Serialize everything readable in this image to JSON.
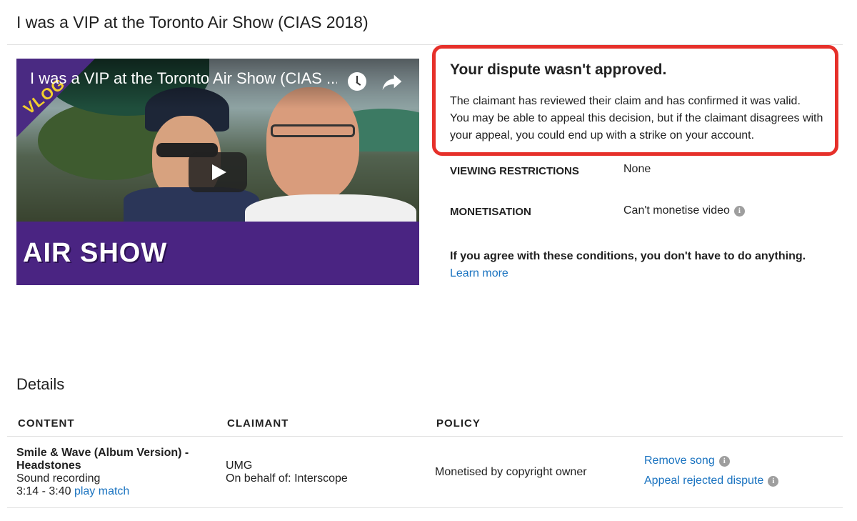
{
  "page_title": "I was a VIP at the Toronto Air Show (CIAS 2018)",
  "video": {
    "overlay_title": "I was a VIP at the Toronto Air Show (CIAS ...",
    "badge_text": "VLOG",
    "banner_text": "AIR SHOW"
  },
  "dispute": {
    "title": "Your dispute wasn't approved.",
    "line1": "The claimant has reviewed their claim and has confirmed it was valid.",
    "line2": "You may be able to appeal this decision, but if the claimant disagrees with",
    "line3": "your appeal, you could end up with a strike on your account.",
    "border_color": "#e6302a"
  },
  "restrictions": {
    "viewing_label": "VIEWING RESTRICTIONS",
    "viewing_value": "None",
    "monetisation_label": "MONETISATION",
    "monetisation_value": "Can't monetise video"
  },
  "notice": {
    "agree_text": "If you agree with these conditions, you don't have to do anything.",
    "learn_more": "Learn more"
  },
  "details": {
    "heading": "Details",
    "columns": [
      "CONTENT",
      "CLAIMANT",
      "POLICY"
    ],
    "row": {
      "content_title_line1": "Smile & Wave (Album Version) -",
      "content_title_line2": "Headstones",
      "content_type": "Sound recording",
      "time_range": "3:14 - 3:40",
      "play_match": "play match",
      "claimant": "UMG",
      "claimant_behalf": "On behalf of: Interscope",
      "policy": "Monetised by copyright owner",
      "actions": [
        "Remove song",
        "Appeal rejected dispute"
      ]
    }
  },
  "colors": {
    "link": "#1a73c0",
    "banner": "#4a2482"
  },
  "icons": {
    "info": "info-icon",
    "watch_later": "clock-icon",
    "share": "share-icon",
    "play": "play-icon"
  }
}
